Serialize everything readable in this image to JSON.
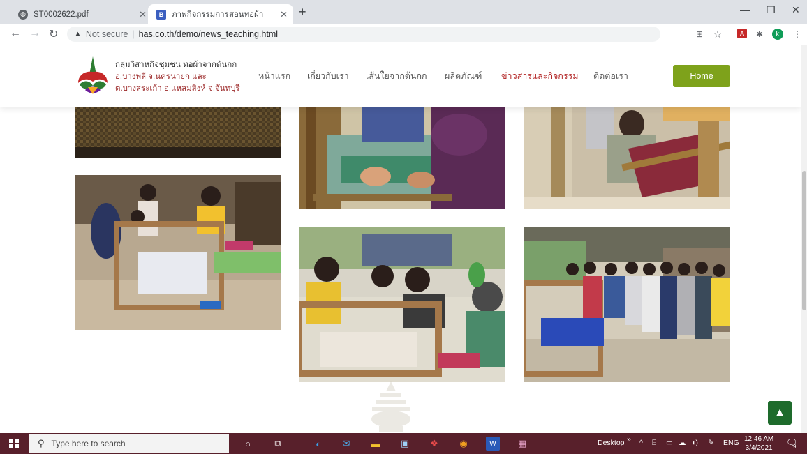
{
  "browser": {
    "tabs": [
      {
        "title": "ST0002622.pdf"
      },
      {
        "title": "ภาพกิจกรรมการสอนทอผ้า"
      }
    ],
    "omnibox": {
      "security_label": "Not secure",
      "url": "has.co.th/demo/news_teaching.html"
    },
    "profile_initial": "k"
  },
  "site": {
    "logo_lines": [
      "กลุ่มวิสาหกิจชุมชน ทอผ้าจากต้นกก",
      "อ.บางพลี จ.นครนายก และ",
      "ต.บางสระเก้า อ.แหลมสิงห์ จ.จันทบุรี"
    ],
    "nav": [
      {
        "label": "หน้าแรก"
      },
      {
        "label": "เกี่ยวกับเรา"
      },
      {
        "label": "เส้นใยจากต้นกก"
      },
      {
        "label": "ผลิตภัณฑ์"
      },
      {
        "label": "ข่าวสารและกิจกรรม"
      },
      {
        "label": "ติดต่อเรา"
      }
    ],
    "home_button": "Home"
  },
  "taskbar": {
    "search_placeholder": "Type here to search",
    "desktop_label": "Desktop",
    "language": "ENG",
    "time": "12:46 AM",
    "date": "3/4/2021",
    "notification_count": "9"
  },
  "colors": {
    "nav_active": "#b22222",
    "home_button": "#7ea21b",
    "back_to_top": "#1e6b2c",
    "taskbar": "#58202b"
  }
}
